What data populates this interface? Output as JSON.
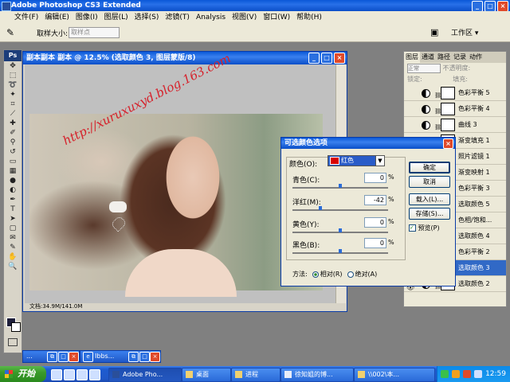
{
  "app": {
    "title": "Adobe Photoshop CS3 Extended"
  },
  "menu": [
    "文件(F)",
    "编辑(E)",
    "图像(I)",
    "图层(L)",
    "选择(S)",
    "滤镜(T)",
    "Analysis",
    "视图(V)",
    "窗口(W)",
    "帮助(H)"
  ],
  "options": {
    "sample_label": "取样大小:",
    "sample_value": "取样点",
    "workspace": "工作区 ▾"
  },
  "document": {
    "title": "副本副本 副本 @ 12.5% (选取颜色 3, 图层蒙版/8)",
    "status": "文档:34.9M/141.0M"
  },
  "watermark": {
    "text": "http://xuruxuxyd.blog.163.com"
  },
  "layers_panel": {
    "tabs": [
      "图层",
      "通道",
      "路径",
      "记录",
      "动作"
    ],
    "mode": "正常",
    "opacity_label": "不透明度:",
    "fill_label": "填充:",
    "lock_label": "锁定:",
    "layers": [
      {
        "name": "色彩平衡 5",
        "selected": false
      },
      {
        "name": "色彩平衡 4",
        "selected": false
      },
      {
        "name": "曲线 3",
        "selected": false
      },
      {
        "name": "渐变填充 1",
        "selected": false
      },
      {
        "name": "照片滤镜 1",
        "selected": false
      },
      {
        "name": "渐变映射 1",
        "selected": false
      },
      {
        "name": "色彩平衡 3",
        "selected": false
      },
      {
        "name": "选取颜色 5",
        "selected": false
      },
      {
        "name": "色相/饱和...",
        "selected": false
      },
      {
        "name": "选取颜色 4",
        "selected": false
      },
      {
        "name": "色彩平衡 2",
        "selected": false
      },
      {
        "name": "选取颜色 3",
        "selected": true
      },
      {
        "name": "选取颜色 2",
        "selected": false
      }
    ]
  },
  "dialog": {
    "title": "可选颜色选项",
    "color_label": "颜色(O):",
    "color_value": "红色",
    "sliders": [
      {
        "label": "青色(C):",
        "value": "0",
        "unit": "%",
        "position": 0.5
      },
      {
        "label": "洋红(M):",
        "value": "-42",
        "unit": "%",
        "position": 0.29
      },
      {
        "label": "黄色(Y):",
        "value": "0",
        "unit": "%",
        "position": 0.5
      },
      {
        "label": "黑色(B):",
        "value": "0",
        "unit": "%",
        "position": 0.5
      }
    ],
    "buttons": {
      "ok": "确定",
      "cancel": "取消",
      "load": "载入(L)...",
      "save": "存储(S)..."
    },
    "preview_label": "预览(P)",
    "method_label": "方法:",
    "relative_label": "相对(R)",
    "absolute_label": "绝对(A)"
  },
  "minimized": [
    "...",
    "Ibbs..."
  ],
  "taskbar": {
    "start": "开始",
    "tasks": [
      "Adobe Pho...",
      "桌面",
      "进程",
      "徐知姐的博...",
      "\\\\002\\本..."
    ],
    "clock": "12:59"
  },
  "colors": {
    "accent": "#0a58d8",
    "selected": "#3169c6",
    "taskbar": "#2058c8",
    "start": "#3a9a2a"
  }
}
